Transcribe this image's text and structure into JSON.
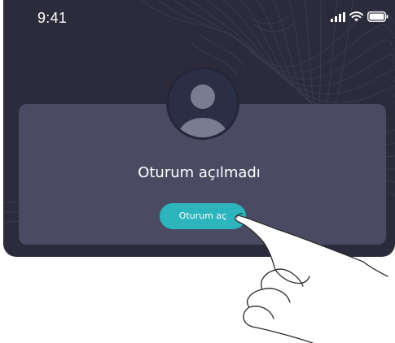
{
  "status_bar": {
    "time": "9:41",
    "icons": [
      "signal-icon",
      "wifi-icon",
      "battery-icon"
    ]
  },
  "avatar": {
    "icon": "user-avatar-icon"
  },
  "message": {
    "title": "Oturum açılmadı"
  },
  "action": {
    "button_label": "Oturum aç"
  },
  "colors": {
    "background": "#2b2b3b",
    "card": "#4a4a63",
    "avatar_bg": "#2b2f45",
    "avatar_fg": "#7a7d90",
    "button": "#2cb5bd",
    "text": "#ffffff"
  }
}
